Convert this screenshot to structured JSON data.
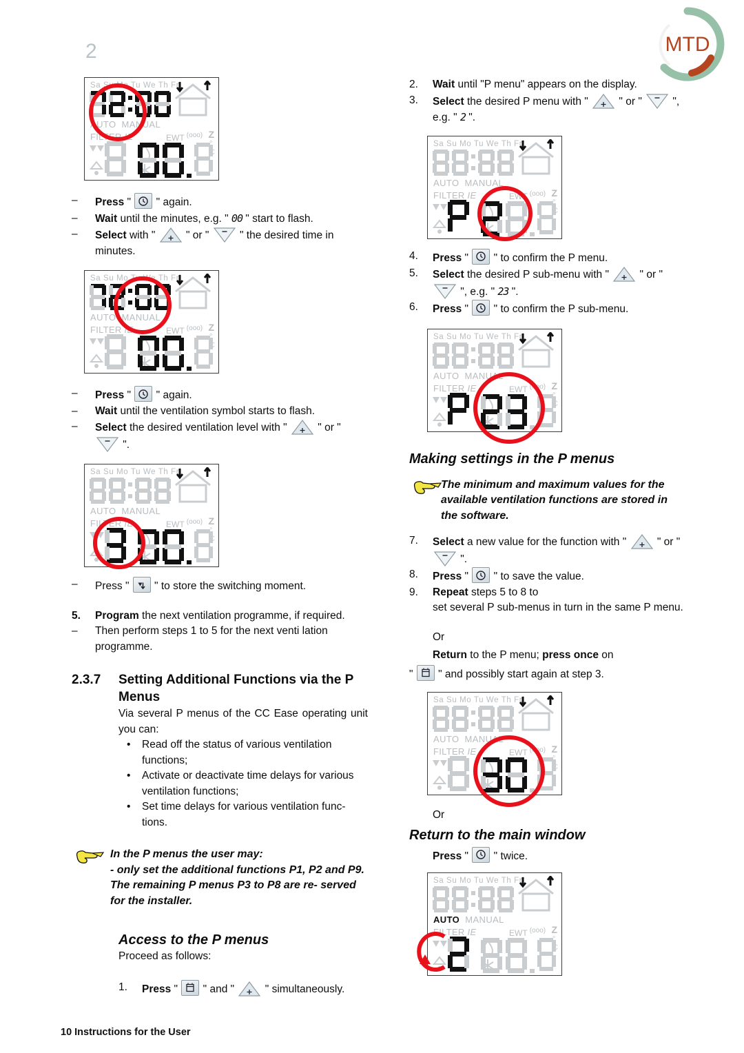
{
  "page": {
    "chapter_number": "2",
    "footer": "10  Instructions for the User",
    "logo_text": "MTD"
  },
  "lcd_common": {
    "weekdays": "Sa Su Mo Tu We Th Fri",
    "auto": "AUTO",
    "manual": "MANUAL",
    "filter": "FILTER",
    "filter_ie": "IE",
    "ewt": "EWT",
    "ewt_sup": "(ooo)",
    "z_symbol": "Z",
    "deg": "°",
    "unit_c": "C"
  },
  "left_column": {
    "lcd1": {
      "clock": "07:00",
      "main": "00",
      "left_digit": "8",
      "highlight": "hours"
    },
    "steps1": [
      {
        "marker": "–",
        "bold": "Press",
        "text_after": "\" ",
        "icon": "clock-key",
        "tail": " \" again."
      },
      {
        "marker": "–",
        "bold": "Wait",
        "text_after": " until the minutes, e.g. \" ",
        "seg": "00",
        "tail": " \" start to flash."
      },
      {
        "marker": "–",
        "bold": "Select",
        "text_after": " with \" ",
        "icon": "plus-triangle",
        "mid": " \" or \" ",
        "icon2": "minus-triangle",
        "tail": " \" the desired time in minutes."
      }
    ],
    "lcd2": {
      "clock": "07:00",
      "main": "00",
      "left_digit": "8",
      "highlight": "minutes"
    },
    "steps2": [
      {
        "marker": "–",
        "bold": "Press",
        "text_after": "\" ",
        "icon": "clock-key",
        "tail": " \" again."
      },
      {
        "marker": "–",
        "bold": "Wait",
        "text_after": " until the ventilation symbol starts to flash."
      },
      {
        "marker": "–",
        "bold": "Select",
        "text_after": " the desired ventilation level with \" ",
        "icon": "plus-triangle",
        "mid": " \" or \" ",
        "icon2": "minus-triangle",
        "tail": " \"."
      }
    ],
    "lcd3": {
      "clock": "88:88",
      "main": "00",
      "left_digit": "3",
      "highlight": "level"
    },
    "step_store": {
      "marker": "–",
      "bold": "Press",
      "text_after": "\" ",
      "icon": "fan-key",
      "tail": " \" to store the switching moment."
    },
    "step5": {
      "marker": "5.",
      "bold": "Program",
      "text_after": " the next ventilation programme, if required."
    },
    "step5_sub": {
      "marker": "–",
      "text": "Then perform steps 1 to 5 for the next venti lation programme."
    },
    "section": {
      "number": "2.3.7",
      "title": "Setting Additional Functions via the P Menus",
      "intro": "Via several P menus of the CC Ease operating unit you can:",
      "bullets": [
        "Read off the status of various ventilation functions;",
        "Activate or deactivate time delays for various ventilation functions;",
        "Set time delays for various ventilation func- tions."
      ]
    },
    "note": {
      "line1": "In the P menus the user may:",
      "line2": "- only set the additional functions P1, P2 and P9.",
      "line3": "The remaining P menus P3 to P8 are re- served for the installer."
    },
    "access_heading": "Access to the P menus",
    "access_intro": "Proceed as follows:",
    "access_step1": {
      "marker": "1.",
      "bold": "Press",
      "text_after": "\" ",
      "icon": "calendar-key",
      "mid": " \" and \" ",
      "icon2": "plus-triangle",
      "tail": " \" simultaneously."
    }
  },
  "right_column": {
    "step2": {
      "marker": "2.",
      "bold": "Wait",
      "text_after": " until \"P menu\" appears on the display."
    },
    "step3": {
      "marker": "3.",
      "bold": "Select",
      "text_after": " the desired P menu with \" ",
      "icon": "plus-triangle",
      "mid": " \" or \" ",
      "icon2": "minus-triangle",
      "tail": " \", e.g. \" ",
      "seg": "2",
      "tail2": " \"."
    },
    "lcd4": {
      "clock": "88:88",
      "main": "2",
      "left_digit": "P",
      "highlight": "p-value"
    },
    "step4": {
      "marker": "4.",
      "bold": "Press",
      "text_after": "\" ",
      "icon": "clock-key",
      "tail": " \" to confirm the P menu."
    },
    "step5": {
      "marker": "5.",
      "bold": "Select",
      "text_after": " the desired P sub-menu with \" ",
      "icon": "plus-triangle",
      "mid": " \" or \" ",
      "icon2": "minus-triangle",
      "tail": " \", e.g. \" ",
      "seg": "23",
      "tail2": " \"."
    },
    "step6": {
      "marker": "6.",
      "bold": "Press",
      "text_after": "\" ",
      "icon": "clock-key",
      "tail": " \" to confirm the P sub-menu."
    },
    "lcd5": {
      "clock": "88:88",
      "main": "23",
      "left_digit": "P",
      "highlight": "p-sub"
    },
    "heading_making": "Making settings in the P menus",
    "note": {
      "line1": "The minimum and maximum values for the available ventilation functions are stored in the software."
    },
    "step7": {
      "marker": "7.",
      "bold": "Select",
      "text_after": " a new value for the function with \" ",
      "icon": "plus-triangle",
      "mid": " \" or \" ",
      "icon2": "minus-triangle",
      "tail": " \"."
    },
    "step8": {
      "marker": "8.",
      "bold": "Press",
      "text_after": "\" ",
      "icon": "clock-key",
      "tail": " \" to save the value."
    },
    "step9": {
      "marker": "9.",
      "bold": "Repeat",
      "text_after": " steps 5 to 8 to"
    },
    "step9_cont": "set several P sub-menus in turn in the same P menu.",
    "or_1": "Or",
    "return_p": {
      "bold1": "Return",
      "mid1": " to the P menu; ",
      "bold2": "press once",
      "mid2": " on",
      "line2_pre": "\" ",
      "icon": "calendar-key",
      "line2_post": " \" and possibly start again at step 3."
    },
    "lcd6": {
      "clock": "88:88",
      "main": "30",
      "left_digit": "8",
      "highlight": "value"
    },
    "or_2": "Or",
    "heading_return": "Return to the main window",
    "press_twice": {
      "bold": "Press",
      "text_after": "\" ",
      "icon": "clock-key",
      "tail": " \" twice."
    },
    "lcd7": {
      "clock": "88:88",
      "main": "88.8",
      "left_digit": "2",
      "auto_on": true,
      "highlight": "left-arrow"
    }
  },
  "colors": {
    "ring_red": "#e8101a",
    "lcd_grey": "#b9bdc0",
    "lcd_dark": "#111111",
    "logo_green": "#96c0a8",
    "logo_brown": "#b4451f",
    "page_num_grey": "#b9c2c6"
  }
}
